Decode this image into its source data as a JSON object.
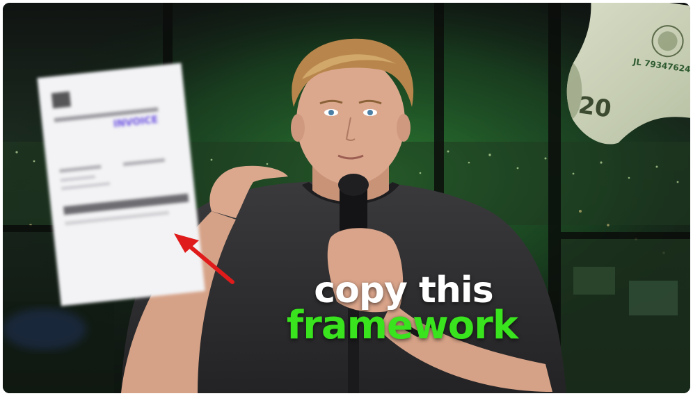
{
  "thumbnail": {
    "caption_line1": "copy this",
    "caption_line2": "framework",
    "invoice_label": "INVOICE",
    "bill_label": "20",
    "bill_serial": "JL 79347624",
    "colors": {
      "caption_white": "#ffffff",
      "caption_green": "#39e31d",
      "arrow_red": "#e01b1b",
      "backdrop_green": "#2e8a35",
      "shirt": "#2a2a2c",
      "skin": "#d9a48a",
      "hair": "#b8864c"
    }
  }
}
